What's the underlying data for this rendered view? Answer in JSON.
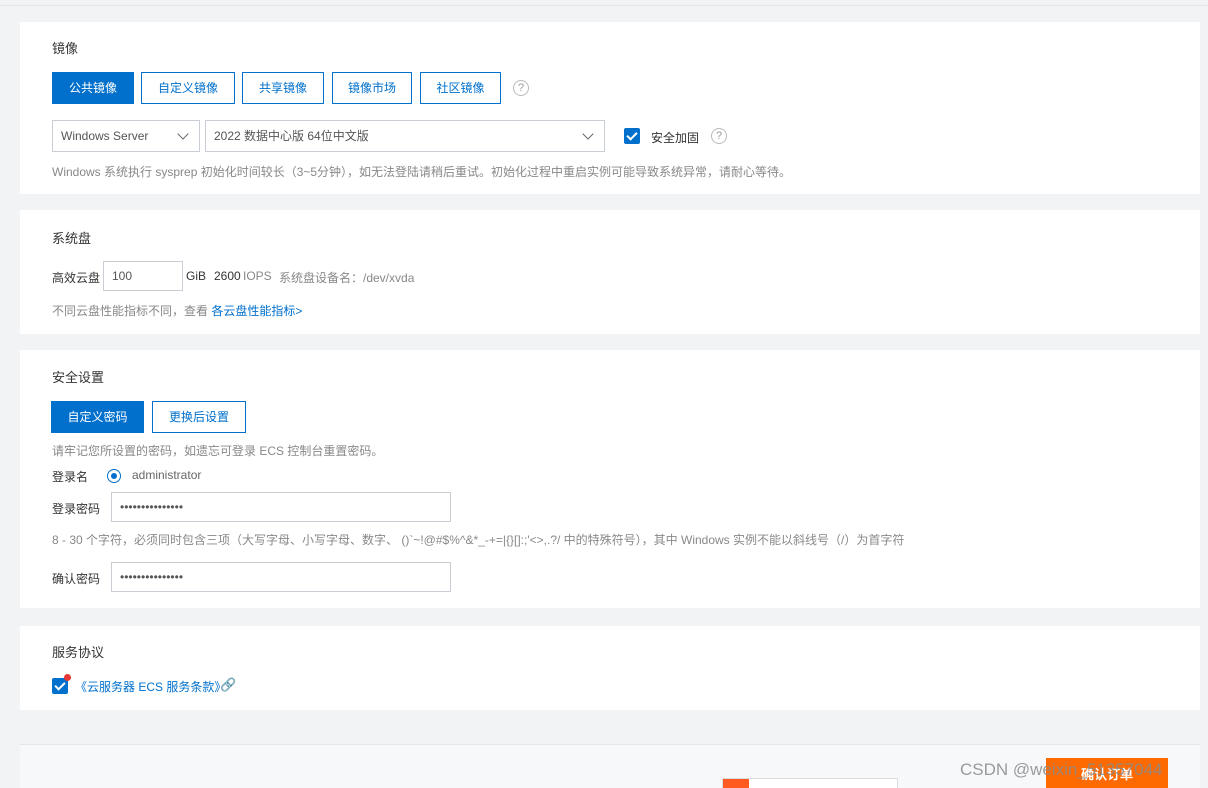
{
  "image_section": {
    "title": "镜像",
    "tabs": [
      "公共镜像",
      "自定义镜像",
      "共享镜像",
      "镜像市场",
      "社区镜像"
    ],
    "help_icon": "?",
    "os_select": "Windows Server",
    "version_select": "2022 数据中心版 64位中文版",
    "security_label": "安全加固",
    "hint": "Windows 系统执行 sysprep 初始化时间较长（3~5分钟），如无法登陆请稍后重试。初始化过程中重启实例可能导致系统异常，请耐心等待。"
  },
  "disk_section": {
    "title": "系统盘",
    "disk_type": "高效云盘",
    "size_value": "100",
    "unit": "GiB",
    "iops_value": "2600",
    "iops_label": "IOPS",
    "device_label": "系统盘设备名：/dev/xvda",
    "hint_prefix": "不同云盘性能指标不同，查看",
    "hint_link": "各云盘性能指标>"
  },
  "security_section": {
    "title": "安全设置",
    "tabs": [
      "自定义密码",
      "更换后设置"
    ],
    "hint": "请牢记您所设置的密码，如遗忘可登录 ECS 控制台重置密码。",
    "login_name_label": "登录名",
    "login_name_value": "administrator",
    "password_label": "登录密码",
    "password_value": "•••••••••••••••",
    "password_rule": "8 - 30 个字符，必须同时包含三项（大写字母、小写字母、数字、 ()`~!@#$%^&*_-+=|{}[]:;'<>,.?/ 中的特殊符号），其中 Windows 实例不能以斜线号（/）为首字符",
    "confirm_label": "确认密码",
    "confirm_value": "•••••••••••••••"
  },
  "agreement_section": {
    "title": "服务协议",
    "link": "《云服务器 ECS 服务条款》"
  },
  "footer": {
    "order_button": "确认订单",
    "watermark": "CSDN @weixin_51357044"
  },
  "colors": {
    "primary": "#0070cc",
    "order": "#ff6a00",
    "background": "#f2f3f5"
  }
}
